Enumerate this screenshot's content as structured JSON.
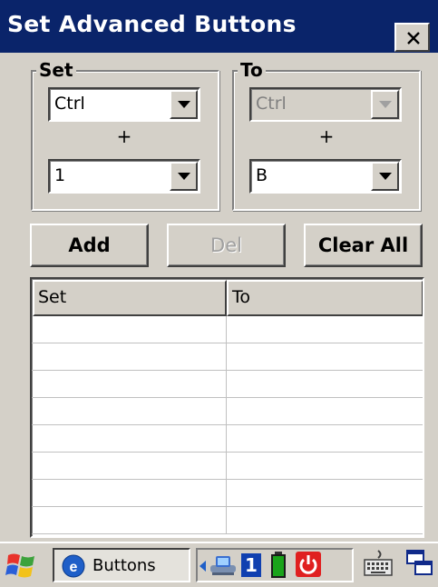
{
  "window": {
    "title": "Set Advanced Buttons",
    "close_label": "close"
  },
  "set_group": {
    "legend": "Set",
    "modifier_value": "Ctrl",
    "plus": "+",
    "key_value": "1"
  },
  "to_group": {
    "legend": "To",
    "modifier_value": "Ctrl",
    "modifier_disabled": true,
    "plus": "+",
    "key_value": "B"
  },
  "buttons": {
    "add": "Add",
    "del": "Del",
    "del_disabled": true,
    "clear_all": "Clear All"
  },
  "list": {
    "columns": [
      "Set",
      "To"
    ],
    "rows": [
      [
        "",
        ""
      ],
      [
        "",
        ""
      ],
      [
        "",
        ""
      ],
      [
        "",
        ""
      ],
      [
        "",
        ""
      ],
      [
        "",
        ""
      ],
      [
        "",
        ""
      ],
      [
        "",
        ""
      ]
    ]
  },
  "taskbar": {
    "start_icon": "windows-flag-icon",
    "task_label": "Buttons",
    "tray_number": "1",
    "tray_icons": [
      "network-icon",
      "battery-icon",
      "power-icon"
    ],
    "keyboard_icon": "keyboard-icon",
    "desktop_icon": "switch-window-icon"
  },
  "colors": {
    "titlebar": "#0a246a",
    "face": "#d4d0c8",
    "battery": "#1aa31a",
    "power": "#e02020"
  }
}
